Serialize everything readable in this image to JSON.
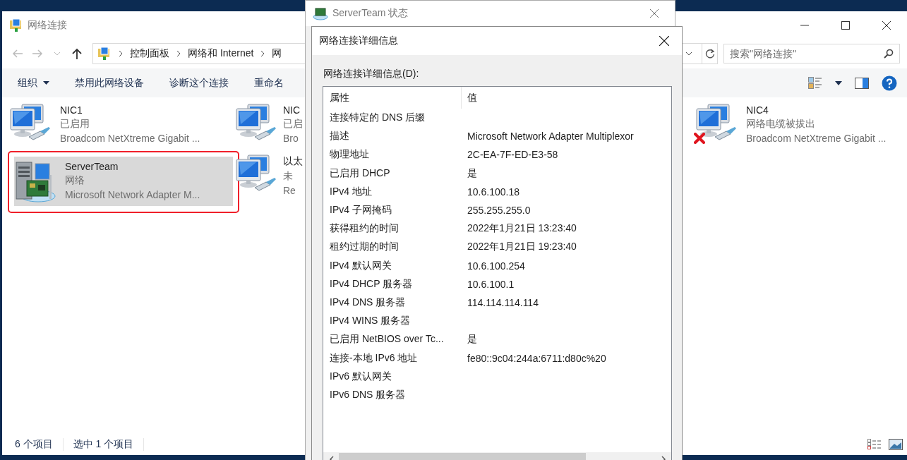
{
  "explorer": {
    "title": "网络连接",
    "breadcrumb": [
      "控制面板",
      "网络和 Internet",
      "网"
    ],
    "search": {
      "placeholder": "搜索\"网络连接\""
    },
    "toolbar": [
      {
        "label": "组织",
        "kind": "menu"
      },
      {
        "label": "禁用此网络设备",
        "kind": "command"
      },
      {
        "label": "诊断这个连接",
        "kind": "command"
      },
      {
        "label": "重命名",
        "kind": "command"
      }
    ],
    "columns": [
      {
        "items": [
          {
            "name": "NIC1",
            "status": "已启用",
            "device": "Broadcom NetXtreme Gigabit ...",
            "kind": "computer",
            "selected": false,
            "highlighted": false,
            "disconnected": false
          },
          {
            "name": "ServerTeam",
            "status": "网络",
            "device": "Microsoft Network Adapter M...",
            "kind": "server",
            "selected": true,
            "highlighted": true,
            "disconnected": false
          }
        ]
      },
      {
        "items": [
          {
            "name": "NIC",
            "status": "已启",
            "device": "Bro",
            "kind": "computer",
            "selected": false,
            "highlighted": false,
            "disconnected": false
          },
          {
            "name": "以太",
            "status": "未",
            "device": "Re",
            "kind": "computer",
            "selected": false,
            "highlighted": false,
            "disconnected": false
          }
        ]
      },
      {
        "items": [
          {
            "name": "NIC4",
            "status": "网络电缆被拔出",
            "device": "Broadcom NetXtreme Gigabit ...",
            "kind": "computer",
            "selected": false,
            "highlighted": false,
            "disconnected": true
          }
        ]
      }
    ],
    "status_bar": [
      "6 个项目",
      "选中 1 个项目"
    ]
  },
  "status_window": {
    "title": "ServerTeam 状态"
  },
  "details_dialog": {
    "title": "网络连接详细信息",
    "label": "网络连接详细信息(D):",
    "columns": [
      "属性",
      "值"
    ],
    "rows": [
      {
        "property": "连接特定的 DNS 后缀"
      },
      {
        "property": "描述",
        "value": "Microsoft Network Adapter Multiplexor"
      },
      {
        "property": "物理地址",
        "value": "2C-EA-7F-ED-E3-58"
      },
      {
        "property": "已启用 DHCP",
        "value": "是"
      },
      {
        "property": "IPv4 地址",
        "value": "10.6.100.18"
      },
      {
        "property": "IPv4 子网掩码",
        "value": "255.255.255.0"
      },
      {
        "property": "获得租约的时间",
        "value": "2022年1月21日 13:23:40"
      },
      {
        "property": "租约过期的时间",
        "value": "2022年1月21日 19:23:40"
      },
      {
        "property": "IPv4 默认网关",
        "value": "10.6.100.254"
      },
      {
        "property": "IPv4 DHCP 服务器",
        "value": "10.6.100.1"
      },
      {
        "property": "IPv4 DNS 服务器",
        "value": "114.114.114.114"
      },
      {
        "property": "IPv4 WINS 服务器"
      },
      {
        "property": "已启用 NetBIOS over Tc...",
        "value": "是"
      },
      {
        "property": "连接-本地 IPv6 地址",
        "value": "fe80::9c04:244a:6711:d80c%20"
      },
      {
        "property": "IPv6 默认网关"
      },
      {
        "property": "IPv6 DNS 服务器"
      }
    ]
  }
}
